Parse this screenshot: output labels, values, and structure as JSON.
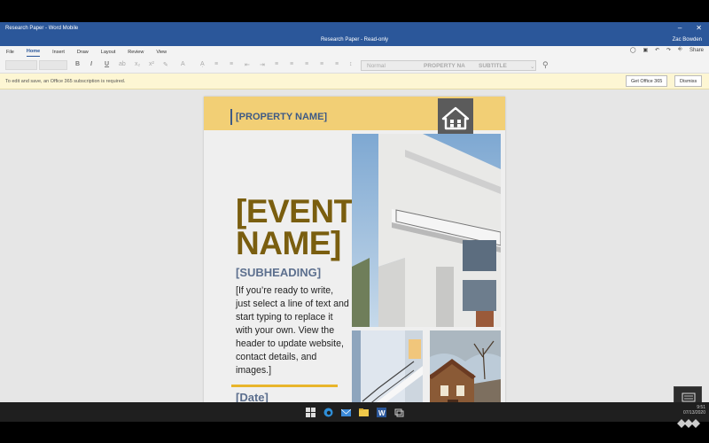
{
  "window": {
    "app_title": "Research Paper - Word Mobile",
    "doc_title": "Research Paper - Read-only",
    "user": "Zac Bowden",
    "minimize": "–",
    "close": "✕"
  },
  "tabs": [
    {
      "label": "File"
    },
    {
      "label": "Home",
      "active": true
    },
    {
      "label": "Insert"
    },
    {
      "label": "Draw"
    },
    {
      "label": "Layout"
    },
    {
      "label": "Review"
    },
    {
      "label": "View"
    }
  ],
  "tab_tools": {
    "share_label": "Share"
  },
  "toolbar": {
    "bold": "B",
    "italic": "I",
    "underline": "U",
    "style_current": "Normal",
    "style_option_2": "PROPERTY NA",
    "style_option_3": "SUBTITLE"
  },
  "message_bar": {
    "text": "To edit and save, an Office 365 subscription is required.",
    "get_office_label": "Get Office 365",
    "dismiss_label": "Dismiss"
  },
  "document": {
    "property_name": "[PROPERTY NAME]",
    "event_name_line1": "[EVENT",
    "event_name_line2": "NAME]",
    "subheading": "[SUBHEADING]",
    "body": "[If you’re ready to write, just select a line of text and start typing to replace it with your own. View the header to update website, contact details, and images.]",
    "date": "[Date]"
  },
  "colors": {
    "title_bar": "#2b579a",
    "gold_band": "#f2cf75",
    "event_name": "#7a5e0f",
    "accent_blue": "#3e5a86",
    "banner": "#5b5b5b",
    "date_line": "#e8b52b"
  },
  "clock": {
    "time": "9:51",
    "date": "07/13/2020"
  }
}
